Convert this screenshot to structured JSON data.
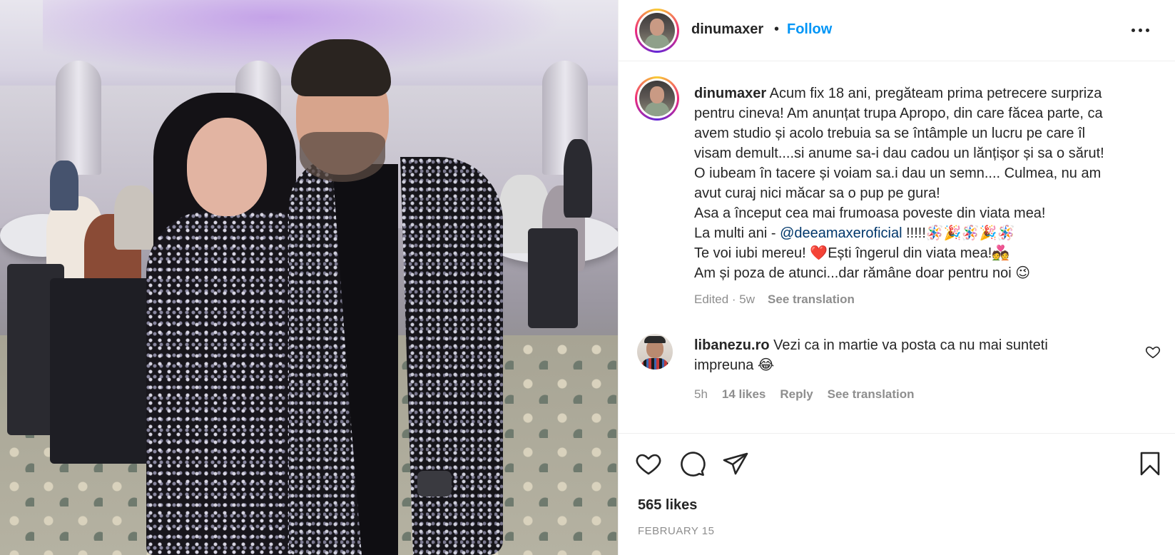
{
  "post": {
    "username": "dinumaxer",
    "separator": "•",
    "follow_label": "Follow",
    "more_options_icon": "more-horizontal-icon",
    "caption_lines": [
      "Acum fix 18 ani, pregăteam prima petrecere surpriza",
      "pentru cineva! Am anunțat trupa Apropo, din care făcea parte, ca",
      "avem studio și acolo trebuia sa se întâmple un lucru pe care îl",
      "visam demult....si anume sa-i dau cadou un lănțișor și sa o sărut!",
      "O iubeam în tacere și voiam sa.i dau un semn.... Culmea, nu am",
      "avut curaj nici măcar sa o pup pe gura!",
      "Asa a început cea mai frumoasa poveste din viata mea!"
    ],
    "caption_line8_prefix": "La multi ani - ",
    "caption_mention": "@deeamaxeroficial",
    "caption_line8_suffix": " !!!!!🪅🎉🪅🎉🪅",
    "caption_line9": "Te voi iubi mereu! ❤️Ești îngerul din viata mea!💑",
    "caption_line10": "Am și poza de atunci...dar rămâne doar pentru noi 😉",
    "edited": "Edited · 5w",
    "see_translation": "See translation"
  },
  "comment": {
    "username": "libanezu.ro",
    "text_line1": "Vezi ca in martie va posta ca nu mai sunteti",
    "text_line2": "impreuna 😂",
    "time": "5h",
    "likes": "14 likes",
    "reply": "Reply",
    "see_translation": "See translation",
    "heart_icon": "heart-outline-icon"
  },
  "actions": {
    "like_icon": "heart-icon",
    "comment_icon": "comment-icon",
    "share_icon": "send-icon",
    "save_icon": "bookmark-icon",
    "likes_count": "565 likes",
    "date": "FEBRUARY 15"
  },
  "colors": {
    "follow": "#0095f6",
    "mention": "#00376b",
    "muted": "#8e8e8e",
    "text": "#262626"
  }
}
